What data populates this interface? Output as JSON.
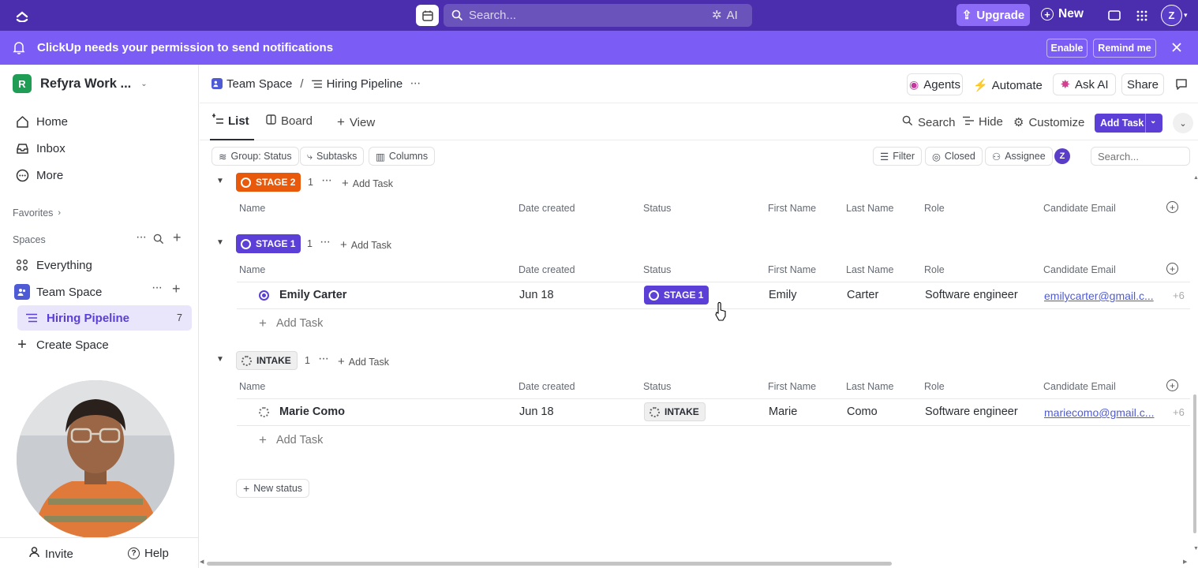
{
  "topbar": {
    "search_placeholder": "Search...",
    "ai_label": "AI",
    "upgrade_label": "Upgrade",
    "new_label": "New",
    "avatar_initial": "Z"
  },
  "notification": {
    "message": "ClickUp needs your permission to send notifications",
    "enable_label": "Enable",
    "remind_label": "Remind me"
  },
  "sidebar": {
    "workspace_initial": "R",
    "workspace_name": "Refyra Work ...",
    "nav": [
      {
        "label": "Home",
        "icon": "home-icon"
      },
      {
        "label": "Inbox",
        "icon": "inbox-icon"
      },
      {
        "label": "More",
        "icon": "more-icon"
      }
    ],
    "favorites_label": "Favorites",
    "spaces_label": "Spaces",
    "everything_label": "Everything",
    "team_space_label": "Team Space",
    "hiring_pipeline_label": "Hiring Pipeline",
    "hiring_pipeline_count": "7",
    "create_space_label": "Create Space",
    "invite_label": "Invite",
    "help_label": "Help"
  },
  "header": {
    "breadcrumb_space": "Team Space",
    "breadcrumb_sep": "/",
    "breadcrumb_list": "Hiring Pipeline",
    "agents_label": "Agents",
    "automate_label": "Automate",
    "ask_ai_label": "Ask AI",
    "share_label": "Share"
  },
  "views": {
    "tabs": [
      "List",
      "Board"
    ],
    "add_view_label": "View",
    "search_label": "Search",
    "hide_label": "Hide",
    "customize_label": "Customize",
    "add_task_label": "Add Task"
  },
  "toolbar": {
    "group_label": "Group: Status",
    "subtasks_label": "Subtasks",
    "columns_label": "Columns",
    "filter_label": "Filter",
    "closed_label": "Closed",
    "assignee_label": "Assignee",
    "assignee_initial": "Z",
    "search_placeholder": "Search..."
  },
  "columns": [
    "Name",
    "Date created",
    "Status",
    "First Name",
    "Last Name",
    "Role",
    "Candidate Email"
  ],
  "groups": [
    {
      "status": "STAGE 2",
      "color": "#e8590c",
      "count": "1",
      "add_task": "Add Task",
      "tasks": []
    },
    {
      "status": "STAGE 1",
      "color": "#5b3fd6",
      "count": "1",
      "add_task": "Add Task",
      "tasks": [
        {
          "name": "Emily Carter",
          "date": "Jun 18",
          "status": "STAGE 1",
          "first": "Emily",
          "last": "Carter",
          "role": "Software engineer",
          "email": "emilycarter@gmail.c...",
          "extra": "+6"
        }
      ],
      "add_task_row": "Add Task"
    },
    {
      "status": "INTAKE",
      "color": "#e6e6e6",
      "count": "1",
      "add_task": "Add Task",
      "tasks": [
        {
          "name": "Marie Como",
          "date": "Jun 18",
          "status": "INTAKE",
          "first": "Marie",
          "last": "Como",
          "role": "Software engineer",
          "email": "mariecomo@gmail.c...",
          "extra": "+6"
        }
      ],
      "add_task_row": "Add Task"
    }
  ],
  "new_status_label": "New status"
}
